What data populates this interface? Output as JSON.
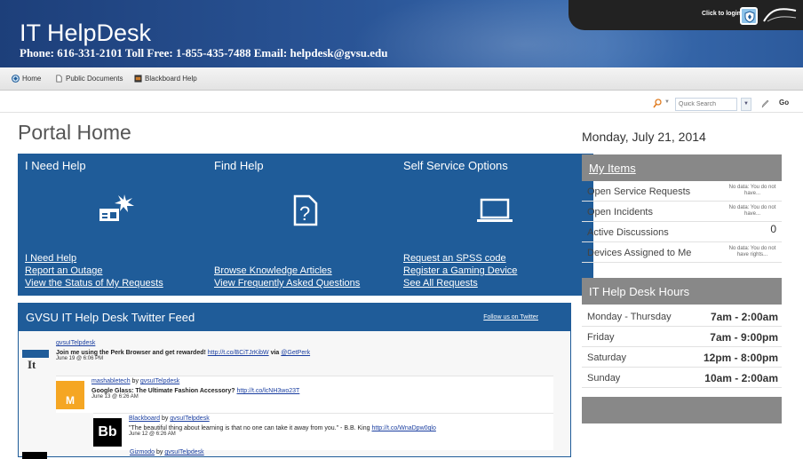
{
  "banner": {
    "title": "IT HelpDesk",
    "contact": "Phone: 616-331-2101 Toll Free: 1-855-435-7488 Email: helpdesk@gvsu.edu",
    "login_label": "Click to login"
  },
  "nav": {
    "items": [
      {
        "label": "Home",
        "icon": "home-icon"
      },
      {
        "label": "Public Documents",
        "icon": "document-icon"
      },
      {
        "label": "Blackboard Help",
        "icon": "blackboard-icon"
      }
    ]
  },
  "search": {
    "placeholder": "Quick Search",
    "go_label": "Go"
  },
  "page_title": "Portal Home",
  "tiles": [
    {
      "title": "I Need Help",
      "icon": "new-ticket-icon",
      "links": [
        "I Need Help",
        "Report an Outage",
        "View the Status of My Requests"
      ]
    },
    {
      "title": "Find Help",
      "icon": "question-document-icon",
      "links": [
        "Browse Knowledge Articles",
        "View Frequently Asked Questions"
      ]
    },
    {
      "title": "Self Service Options",
      "icon": "laptop-icon",
      "links": [
        "Request an SPSS code",
        "Register a Gaming Device",
        "See All Requests"
      ]
    }
  ],
  "twitter": {
    "title": "GVSU IT Help Desk Twitter Feed",
    "follow_label": "Follow us on Twitter",
    "tweets": [
      {
        "author": "gvsuITelpdesk",
        "text": "Join me using the Perk Browser and get rewarded!",
        "link": "http://t.co/BCiTJrKibW",
        "via": "via",
        "mention": "@GetPerk",
        "date": "June 19 @ 6:06 PM"
      },
      {
        "author": "mashabletech",
        "by": "by",
        "by_author": "gvsuITelpdesk",
        "text": "Google Glass: The Ultimate Fashion Accessory?",
        "link": "http://t.co/lcNH3wo23T",
        "date": "June 13 @ 6:26 AM",
        "avatar_letter": "M"
      },
      {
        "author": "Blackboard",
        "by": "by",
        "by_author": "gvsuITelpdesk",
        "text": "\"The beautiful thing about learning is that no one can take it away from you.\" - B.B. King",
        "link": "http://t.co/WnaDpw0qlo",
        "date": "June 12 @ 6:26 AM",
        "avatar_letter": "Bb"
      },
      {
        "author": "Gizmodo",
        "by": "by",
        "by_author": "gvsuITelpdesk"
      }
    ],
    "logo_letters": "It"
  },
  "sidebar": {
    "date": "Monday, July 21, 2014",
    "my_items": {
      "title": "My Items",
      "rows": [
        {
          "label": "Open Service Requests",
          "value": "No data: You do not have..."
        },
        {
          "label": "Open Incidents",
          "value": "No data: You do not have..."
        },
        {
          "label": "Active Discussions",
          "value": "0"
        },
        {
          "label": "Devices Assigned to Me",
          "value": "No data: You do not have rights..."
        }
      ]
    },
    "hours": {
      "title": "IT Help Desk Hours",
      "rows": [
        {
          "day": "Monday - Thursday",
          "time": "7am - 2:00am"
        },
        {
          "day": "Friday",
          "time": "7am - 9:00pm"
        },
        {
          "day": "Saturday",
          "time": "12pm - 8:00pm"
        },
        {
          "day": "Sunday",
          "time": "10am - 2:00am"
        }
      ]
    }
  },
  "colors": {
    "tile_blue": "#1f5c99",
    "panel_gray": "#888888",
    "banner_blue": "#2a5597"
  }
}
